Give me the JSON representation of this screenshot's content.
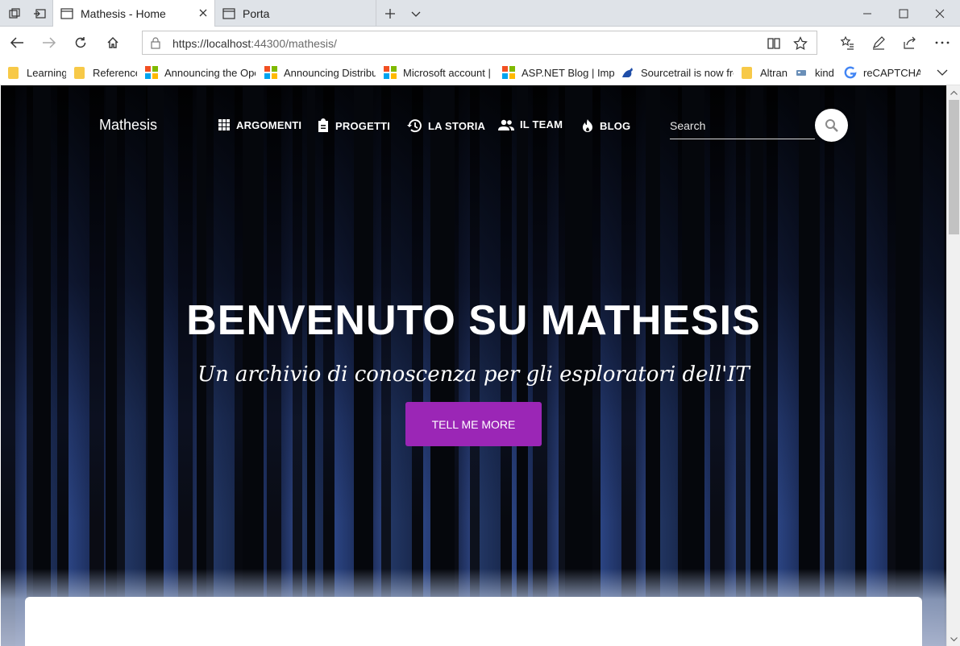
{
  "browser": {
    "tabs": [
      {
        "title": "Mathesis - Home",
        "active": true
      },
      {
        "title": "Porta",
        "active": false
      }
    ],
    "url_host": "https://localhost",
    "url_port_path": ":44300/mathesis/",
    "favorites": [
      {
        "label": "Learning",
        "icon": "folder-icon"
      },
      {
        "label": "Reference",
        "icon": "folder-icon"
      },
      {
        "label": "Announcing the Oper",
        "icon": "microsoft-logo-icon"
      },
      {
        "label": "Announcing Distribut",
        "icon": "microsoft-logo-icon"
      },
      {
        "label": "Microsoft account | R",
        "icon": "microsoft-logo-icon"
      },
      {
        "label": "ASP.NET Blog | Impro",
        "icon": "microsoft-logo-icon"
      },
      {
        "label": "Sourcetrail is now free",
        "icon": "sourcetrail-icon"
      },
      {
        "label": "Altran",
        "icon": "folder-icon"
      },
      {
        "label": "kind",
        "icon": "kind-icon"
      },
      {
        "label": "reCAPTCHA",
        "icon": "google-icon"
      }
    ]
  },
  "site": {
    "brand": "Mathesis",
    "nav": [
      {
        "label": "ARGOMENTI",
        "icon": "grid-icon"
      },
      {
        "label": "PROGETTI",
        "icon": "clipboard-icon"
      },
      {
        "label": "LA STORIA",
        "icon": "history-icon"
      },
      {
        "label": "IL TEAM",
        "icon": "people-icon"
      },
      {
        "label": "BLOG",
        "icon": "flame-icon"
      }
    ],
    "search_placeholder": "Search",
    "hero_title": "BENVENUTO SU MATHESIS",
    "hero_subtitle": "Un archivio di conoscenza per gli esploratori dell'IT",
    "cta_label": "TELL ME MORE",
    "accent_color": "#9b26b6"
  }
}
